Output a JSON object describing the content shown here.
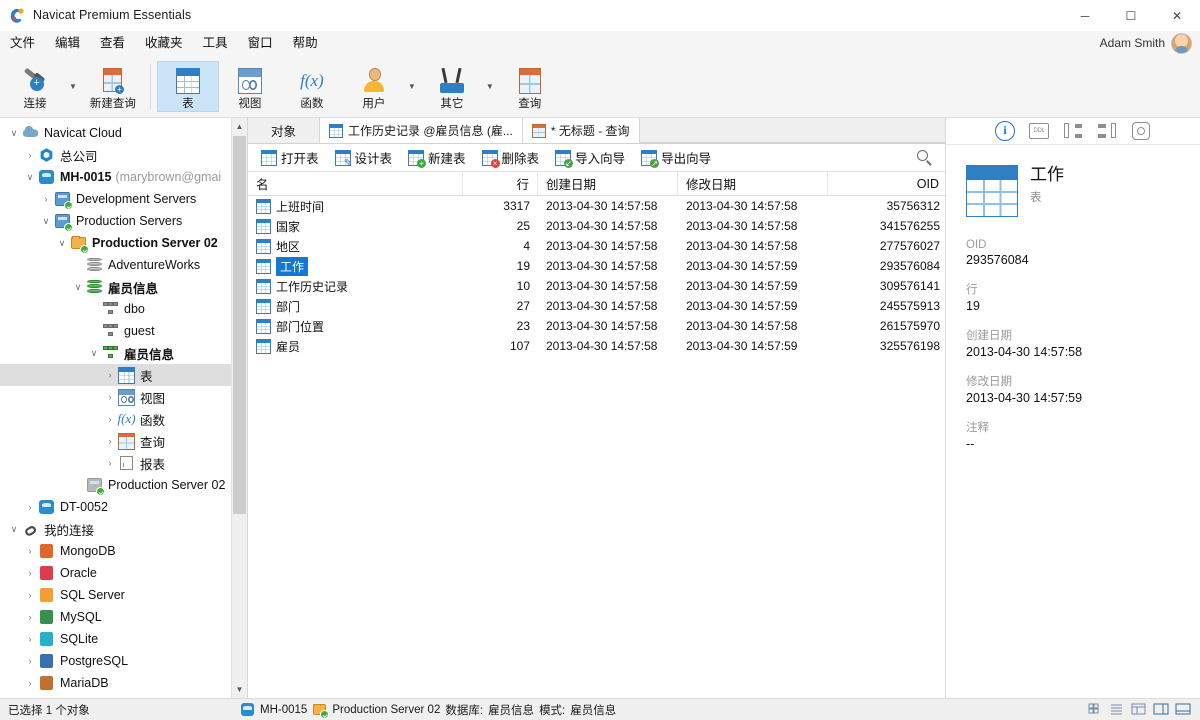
{
  "window": {
    "title": "Navicat Premium Essentials",
    "minimize": "─",
    "maximize": "☐",
    "close": "✕"
  },
  "menubar": {
    "items": [
      "文件",
      "编辑",
      "查看",
      "收藏夹",
      "工具",
      "窗口",
      "帮助"
    ],
    "user_name": "Adam Smith"
  },
  "ribbon": {
    "buttons": [
      {
        "label": "连接",
        "icon": "connection-icon",
        "caret": true,
        "active": false
      },
      {
        "label": "新建查询",
        "icon": "new-query-icon",
        "caret": false,
        "active": false
      },
      {
        "label": "表",
        "icon": "table-icon",
        "caret": false,
        "active": true
      },
      {
        "label": "视图",
        "icon": "view-icon",
        "caret": false,
        "active": false
      },
      {
        "label": "函数",
        "icon": "function-icon",
        "caret": false,
        "active": false
      },
      {
        "label": "用户",
        "icon": "user-icon",
        "caret": true,
        "active": false
      },
      {
        "label": "其它",
        "icon": "other-icon",
        "caret": true,
        "active": false
      },
      {
        "label": "查询",
        "icon": "query-icon",
        "caret": false,
        "active": false
      }
    ]
  },
  "sidebar": {
    "nodes": [
      {
        "label": "Navicat Cloud",
        "sub": "",
        "depth": 0,
        "twist": "down",
        "icon": "cloud-icon",
        "bold": false,
        "selected": false
      },
      {
        "label": "总公司",
        "sub": "",
        "depth": 1,
        "twist": "right",
        "icon": "hex-icon",
        "bold": false,
        "selected": false
      },
      {
        "label": "MH-0015",
        "sub": "(marybrown@gmai",
        "depth": 1,
        "twist": "down",
        "icon": "cloud-server-icon",
        "bold": true,
        "selected": false
      },
      {
        "label": "Development Servers",
        "sub": "",
        "depth": 2,
        "twist": "right",
        "icon": "server-group-icon",
        "bold": false,
        "selected": false
      },
      {
        "label": "Production Servers",
        "sub": "",
        "depth": 2,
        "twist": "down",
        "icon": "server-group-icon",
        "bold": false,
        "selected": false
      },
      {
        "label": "Production Server 02",
        "sub": "",
        "depth": 3,
        "twist": "down",
        "icon": "server-icon",
        "bold": true,
        "selected": false
      },
      {
        "label": "AdventureWorks",
        "sub": "",
        "depth": 4,
        "twist": "none",
        "icon": "database-gray-icon",
        "bold": false,
        "selected": false
      },
      {
        "label": "雇员信息",
        "sub": "",
        "depth": 4,
        "twist": "down",
        "icon": "database-icon",
        "bold": true,
        "selected": false
      },
      {
        "label": "dbo",
        "sub": "",
        "depth": 5,
        "twist": "none",
        "icon": "schema-gray-icon",
        "bold": false,
        "selected": false
      },
      {
        "label": "guest",
        "sub": "",
        "depth": 5,
        "twist": "none",
        "icon": "schema-gray-icon",
        "bold": false,
        "selected": false
      },
      {
        "label": "雇员信息",
        "sub": "",
        "depth": 5,
        "twist": "down",
        "icon": "schema-icon",
        "bold": true,
        "selected": false
      },
      {
        "label": "表",
        "sub": "",
        "depth": 6,
        "twist": "right",
        "icon": "table-icon",
        "bold": false,
        "selected": true
      },
      {
        "label": "视图",
        "sub": "",
        "depth": 6,
        "twist": "right",
        "icon": "view-icon",
        "bold": false,
        "selected": false
      },
      {
        "label": "函数",
        "sub": "",
        "depth": 6,
        "twist": "right",
        "icon": "function-icon",
        "bold": false,
        "selected": false
      },
      {
        "label": "查询",
        "sub": "",
        "depth": 6,
        "twist": "right",
        "icon": "query-icon",
        "bold": false,
        "selected": false
      },
      {
        "label": "报表",
        "sub": "",
        "depth": 6,
        "twist": "right",
        "icon": "report-icon",
        "bold": false,
        "selected": false
      },
      {
        "label": "Production Server 02",
        "sub": "",
        "depth": 4,
        "twist": "none",
        "icon": "server-gray-icon",
        "bold": false,
        "selected": false
      },
      {
        "label": "DT-0052",
        "sub": "",
        "depth": 1,
        "twist": "right",
        "icon": "cloud-server-icon",
        "bold": false,
        "selected": false
      },
      {
        "label": "我的连接",
        "sub": "",
        "depth": 0,
        "twist": "down",
        "icon": "link-icon",
        "bold": false,
        "selected": false
      },
      {
        "label": "MongoDB",
        "sub": "",
        "depth": 1,
        "twist": "right",
        "icon": "mongodb-icon",
        "bold": false,
        "selected": false
      },
      {
        "label": "Oracle",
        "sub": "",
        "depth": 1,
        "twist": "right",
        "icon": "oracle-icon",
        "bold": false,
        "selected": false
      },
      {
        "label": "SQL Server",
        "sub": "",
        "depth": 1,
        "twist": "right",
        "icon": "sqlserver-icon",
        "bold": false,
        "selected": false
      },
      {
        "label": "MySQL",
        "sub": "",
        "depth": 1,
        "twist": "right",
        "icon": "mysql-icon",
        "bold": false,
        "selected": false
      },
      {
        "label": "SQLite",
        "sub": "",
        "depth": 1,
        "twist": "right",
        "icon": "sqlite-icon",
        "bold": false,
        "selected": false
      },
      {
        "label": "PostgreSQL",
        "sub": "",
        "depth": 1,
        "twist": "right",
        "icon": "postgresql-icon",
        "bold": false,
        "selected": false
      },
      {
        "label": "MariaDB",
        "sub": "",
        "depth": 1,
        "twist": "right",
        "icon": "mariadb-icon",
        "bold": false,
        "selected": false
      }
    ]
  },
  "tabs": {
    "static_label": "对象",
    "items": [
      {
        "label": "工作历史记录 @雇员信息 (雇...",
        "icon": "table-icon",
        "active": false
      },
      {
        "label": "* 无标题 - 查询",
        "icon": "query-icon",
        "active": false
      }
    ]
  },
  "objbar": {
    "buttons": [
      {
        "label": "打开表",
        "icon": "open-table-icon"
      },
      {
        "label": "设计表",
        "icon": "design-table-icon"
      },
      {
        "label": "新建表",
        "icon": "new-table-icon"
      },
      {
        "label": "删除表",
        "icon": "delete-table-icon"
      },
      {
        "label": "导入向导",
        "icon": "import-wizard-icon"
      },
      {
        "label": "导出向导",
        "icon": "export-wizard-icon"
      }
    ],
    "search_icon": "search-icon"
  },
  "grid": {
    "columns": [
      "名",
      "行",
      "创建日期",
      "修改日期",
      "OID"
    ],
    "rows": [
      {
        "name": "上班时间",
        "rows": "3317",
        "created": "2013-04-30 14:57:58",
        "modified": "2013-04-30 14:57:58",
        "oid": "35756312",
        "selected": false
      },
      {
        "name": "国家",
        "rows": "25",
        "created": "2013-04-30 14:57:58",
        "modified": "2013-04-30 14:57:58",
        "oid": "341576255",
        "selected": false
      },
      {
        "name": "地区",
        "rows": "4",
        "created": "2013-04-30 14:57:58",
        "modified": "2013-04-30 14:57:58",
        "oid": "277576027",
        "selected": false
      },
      {
        "name": "工作",
        "rows": "19",
        "created": "2013-04-30 14:57:58",
        "modified": "2013-04-30 14:57:59",
        "oid": "293576084",
        "selected": true
      },
      {
        "name": "工作历史记录",
        "rows": "10",
        "created": "2013-04-30 14:57:58",
        "modified": "2013-04-30 14:57:59",
        "oid": "309576141",
        "selected": false
      },
      {
        "name": "部门",
        "rows": "27",
        "created": "2013-04-30 14:57:58",
        "modified": "2013-04-30 14:57:59",
        "oid": "245575913",
        "selected": false
      },
      {
        "name": "部门位置",
        "rows": "23",
        "created": "2013-04-30 14:57:58",
        "modified": "2013-04-30 14:57:58",
        "oid": "261575970",
        "selected": false
      },
      {
        "name": "雇员",
        "rows": "107",
        "created": "2013-04-30 14:57:58",
        "modified": "2013-04-30 14:57:59",
        "oid": "325576198",
        "selected": false
      }
    ]
  },
  "info_panel": {
    "tabs": [
      {
        "icon": "info-icon",
        "active": true
      },
      {
        "icon": "ddl-icon",
        "active": false
      },
      {
        "icon": "er-left-icon",
        "active": false
      },
      {
        "icon": "er-right-icon",
        "active": false
      },
      {
        "icon": "preview-icon",
        "active": false
      }
    ],
    "object_icon": "table-icon",
    "object_title": "工作",
    "object_type": "表",
    "fields": [
      {
        "key": "OID",
        "value": "293576084"
      },
      {
        "key": "行",
        "value": "19"
      },
      {
        "key": "创建日期",
        "value": "2013-04-30 14:57:58"
      },
      {
        "key": "修改日期",
        "value": "2013-04-30 14:57:59"
      },
      {
        "key": "注释",
        "value": "--"
      }
    ]
  },
  "statusbar": {
    "selection_text": "已选择 1 个对象",
    "connection_icon": "cloud-server-icon",
    "connection": "MH-0015",
    "server_icon": "server-icon",
    "server": "Production Server 02",
    "database_label": "数据库:",
    "database": "雇员信息",
    "schema_label": "模式:",
    "schema": "雇员信息",
    "view_buttons": [
      "grid-view-icon",
      "list-view-icon",
      "detail-view-icon",
      "pane-right-icon",
      "pane-bottom-icon"
    ]
  },
  "colors": {
    "accent": "#1477d4",
    "ribbon_active": "#cce4f7",
    "tree_selected": "#dedede",
    "chrome": "#f5f5f5"
  }
}
